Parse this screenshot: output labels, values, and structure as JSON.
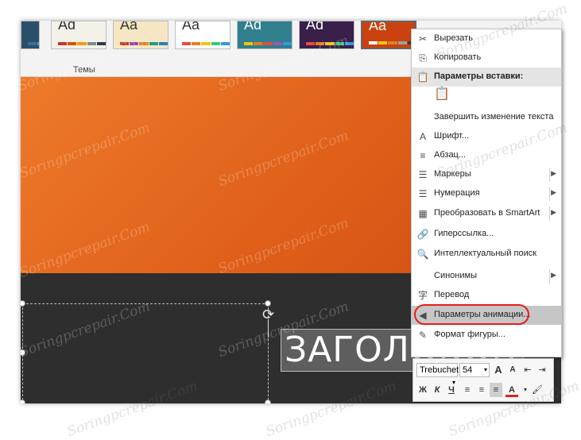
{
  "ribbon": {
    "group_label": "Темы",
    "themes": [
      {
        "aa": "",
        "bg": "#2a4f6b",
        "fg": "#ffffff",
        "bars": [
          "#3a6f9b",
          "#5a8fbb",
          "#7aaad8",
          "#2a4f6b",
          "#1b3f5b"
        ]
      },
      {
        "aa": "Ad",
        "bg": "#f4f1e8",
        "fg": "#333333",
        "bars": [
          "#c0392b",
          "#d35400",
          "#f39c12",
          "#7f8c8d",
          "#2c3e50"
        ]
      },
      {
        "aa": "Aa",
        "bg": "#f7e6c4",
        "fg": "#333333",
        "bars": [
          "#c0392b",
          "#8e44ad",
          "#e67e22",
          "#16a085",
          "#2980b9"
        ]
      },
      {
        "aa": "Aa",
        "bg": "#ffffff",
        "fg": "#333333",
        "bars": [
          "#e74c3c",
          "#e67e22",
          "#f1c40f",
          "#2ecc71",
          "#3498db"
        ]
      },
      {
        "aa": "Ad",
        "bg": "#2f7f8e",
        "fg": "#ffffff",
        "bars": [
          "#f1c40f",
          "#e67e22",
          "#e74c3c",
          "#9b59b6",
          "#3498db"
        ]
      },
      {
        "aa": "Ad",
        "bg": "#3a1f4a",
        "fg": "#ffffff",
        "bars": [
          "#e74c3c",
          "#e67e22",
          "#f1c40f",
          "#2ecc71",
          "#3498db"
        ]
      },
      {
        "aa": "Aa",
        "bg": "#c9420f",
        "fg": "#ffffff",
        "bars": [
          "#ffffff",
          "#f1c40f",
          "#e67e22",
          "#95a5a6",
          "#2c3e50"
        ]
      }
    ]
  },
  "slide": {
    "title_text": "ЗАГОЛОВОК"
  },
  "context_menu": {
    "items": [
      {
        "icon": "✂",
        "label": "Вырезать",
        "type": "item"
      },
      {
        "icon": "⎘",
        "label": "Копировать",
        "type": "item"
      },
      {
        "icon": "📋",
        "label": "Параметры вставки:",
        "type": "header"
      },
      {
        "icon": "",
        "label": "",
        "type": "paste-option"
      },
      {
        "icon": "",
        "label": "Завершить изменение текста",
        "type": "item"
      },
      {
        "icon": "A",
        "label": "Шрифт...",
        "type": "item"
      },
      {
        "icon": "≡",
        "label": "Абзац...",
        "type": "item"
      },
      {
        "icon": "☰",
        "label": "Маркеры",
        "type": "submenu"
      },
      {
        "icon": "☰",
        "label": "Нумерация",
        "type": "submenu"
      },
      {
        "icon": "▦",
        "label": "Преобразовать в SmartArt",
        "type": "submenu"
      },
      {
        "icon": "🔗",
        "label": "Гиперссылка...",
        "type": "item"
      },
      {
        "icon": "🔍",
        "label": "Интеллектуальный поиск",
        "type": "item"
      },
      {
        "icon": "",
        "label": "Синонимы",
        "type": "submenu"
      },
      {
        "icon": "字",
        "label": "Перевод",
        "type": "item"
      },
      {
        "icon": "◀",
        "label": "Параметры анимации...",
        "type": "highlighted"
      },
      {
        "icon": "✎",
        "label": "Формат фигуры...",
        "type": "item"
      }
    ],
    "submenu_arrow": "▶"
  },
  "mini_toolbar": {
    "font_name": "Trebuchet",
    "font_size": "54",
    "grow_font": "A",
    "shrink_font": "A",
    "bold": "Ж",
    "italic": "К",
    "underline": "Ч",
    "font_color_glyph": "A",
    "font_color": "#e81c1c"
  },
  "watermark": "Soringpcrepair.Com"
}
